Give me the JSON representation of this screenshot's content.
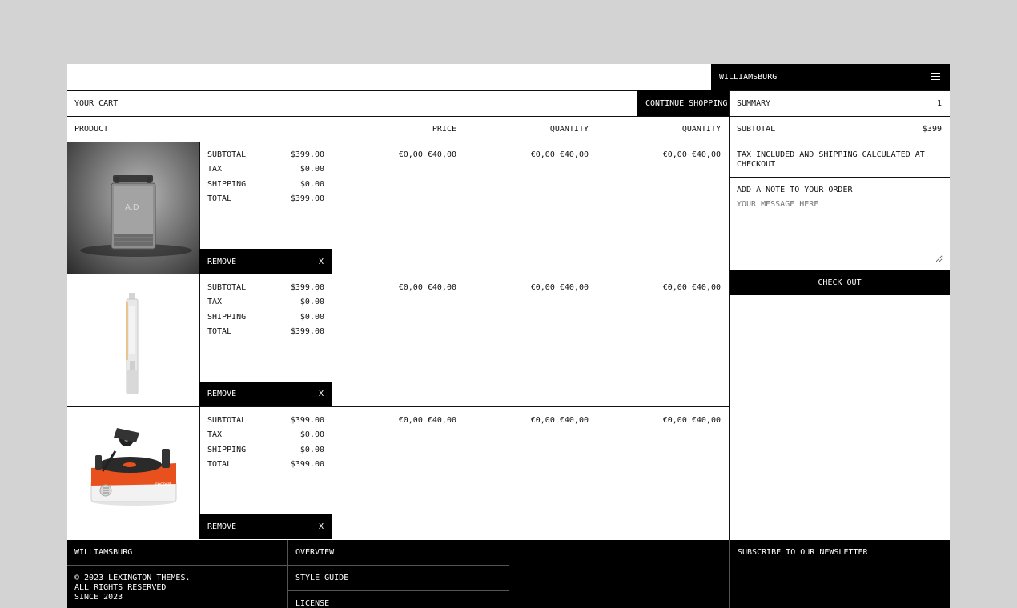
{
  "header": {
    "brand": "WILLIAMSBURG",
    "menu_icon": "hamburger-menu-icon"
  },
  "cart": {
    "title": "YOUR CART",
    "continue_label": "CONTINUE SHOPPING",
    "columns": {
      "product": "PRODUCT",
      "price": "PRICE",
      "quantity": "QUANTITY",
      "quantity2": "QUANTITY"
    },
    "items": [
      {
        "image": "portable-record-player-gray-image",
        "lines": [
          {
            "label": "SUBTOTAL",
            "value": "$399.00"
          },
          {
            "label": "TAX",
            "value": "$0.00"
          },
          {
            "label": "SHIPPING",
            "value": "$0.00"
          },
          {
            "label": "TOTAL",
            "value": "$399.00"
          }
        ],
        "price": "€0,00 €40,00",
        "quantity": "€0,00 €40,00",
        "quantity2": "€0,00 €40,00",
        "remove_label": "REMOVE",
        "remove_x": "X"
      },
      {
        "image": "slim-speaker-image",
        "lines": [
          {
            "label": "SUBTOTAL",
            "value": "$399.00"
          },
          {
            "label": "TAX",
            "value": "$0.00"
          },
          {
            "label": "SHIPPING",
            "value": "$0.00"
          },
          {
            "label": "TOTAL",
            "value": "$399.00"
          }
        ],
        "price": "€0,00 €40,00",
        "quantity": "€0,00 €40,00",
        "quantity2": "€0,00 €40,00",
        "remove_label": "REMOVE",
        "remove_x": "X"
      },
      {
        "image": "orange-turntable-image",
        "lines": [
          {
            "label": "SUBTOTAL",
            "value": "$399.00"
          },
          {
            "label": "TAX",
            "value": "$0.00"
          },
          {
            "label": "SHIPPING",
            "value": "$0.00"
          },
          {
            "label": "TOTAL",
            "value": "$399.00"
          }
        ],
        "price": "€0,00 €40,00",
        "quantity": "€0,00 €40,00",
        "quantity2": "€0,00 €40,00",
        "remove_label": "REMOVE",
        "remove_x": "X"
      }
    ]
  },
  "summary": {
    "title": "SUMMARY",
    "count": "1",
    "subtotal_label": "SUBTOTAL",
    "subtotal_value": "$399",
    "tax_note": "TAX INCLUDED AND SHIPPING CALCULATED AT CHECKOUT",
    "note_label": "ADD A NOTE TO YOUR ORDER",
    "note_placeholder": "YOUR MESSAGE HERE",
    "checkout_label": "CHECK OUT"
  },
  "footer": {
    "brand": "WILLIAMSBURG",
    "copyright_line1": "© 2023 LEXINGTON THEMES.",
    "copyright_line2": "ALL RIGHTS RESERVED",
    "copyright_line3": "SINCE 2023",
    "links": [
      "OVERVIEW",
      "STYLE GUIDE",
      "LICENSE"
    ],
    "newsletter": "SUBSCRIBE TO OUR NEWSLETTER"
  },
  "colors": {
    "background": "#d3d3d4",
    "surface": "#ffffff",
    "ink": "#000000",
    "accent_orange": "#e8501e"
  }
}
